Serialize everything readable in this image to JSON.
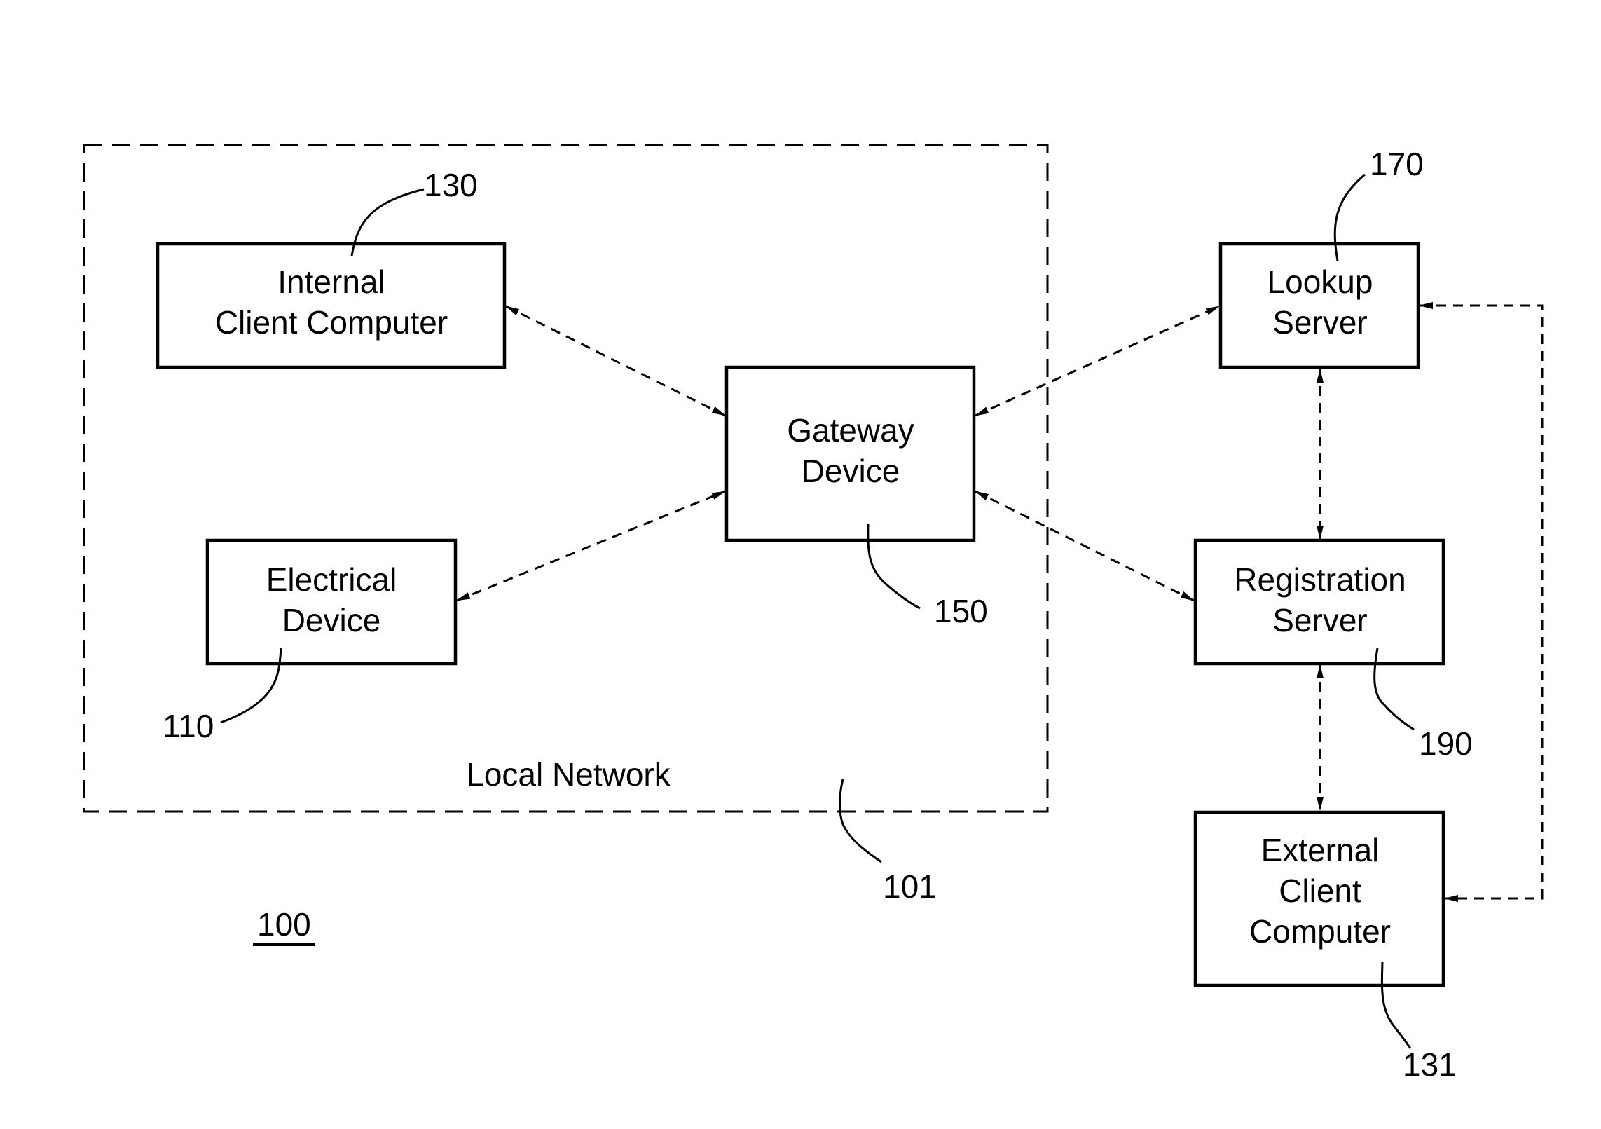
{
  "figure": {
    "number": "100",
    "number_underlined": true
  },
  "region": {
    "label": "Local Network",
    "ref": "101"
  },
  "nodes": {
    "internal_client": {
      "lines": [
        "Internal",
        "Client Computer"
      ],
      "ref": "130"
    },
    "electrical_device": {
      "lines": [
        "Electrical",
        "Device"
      ],
      "ref": "110"
    },
    "gateway": {
      "lines": [
        "Gateway",
        "Device"
      ],
      "ref": "150"
    },
    "lookup_server": {
      "lines": [
        "Lookup",
        "Server"
      ],
      "ref": "170"
    },
    "registration_server": {
      "lines": [
        "Registration",
        "Server"
      ],
      "ref": "190"
    },
    "external_client": {
      "lines": [
        "External",
        "Client",
        "Computer"
      ],
      "ref": "131"
    }
  },
  "connections": [
    {
      "from": "internal_client",
      "to": "gateway",
      "style": "dashed",
      "arrows": "both"
    },
    {
      "from": "electrical_device",
      "to": "gateway",
      "style": "dashed",
      "arrows": "both"
    },
    {
      "from": "gateway",
      "to": "lookup_server",
      "style": "dashed",
      "arrows": "both"
    },
    {
      "from": "gateway",
      "to": "registration_server",
      "style": "dashed",
      "arrows": "both"
    },
    {
      "from": "lookup_server",
      "to": "registration_server",
      "style": "dashed",
      "arrows": "both"
    },
    {
      "from": "registration_server",
      "to": "external_client",
      "style": "dashed",
      "arrows": "both"
    },
    {
      "from": "lookup_server",
      "to": "external_client",
      "style": "dashed",
      "arrows": "both",
      "routing": "orthogonal-right"
    }
  ]
}
